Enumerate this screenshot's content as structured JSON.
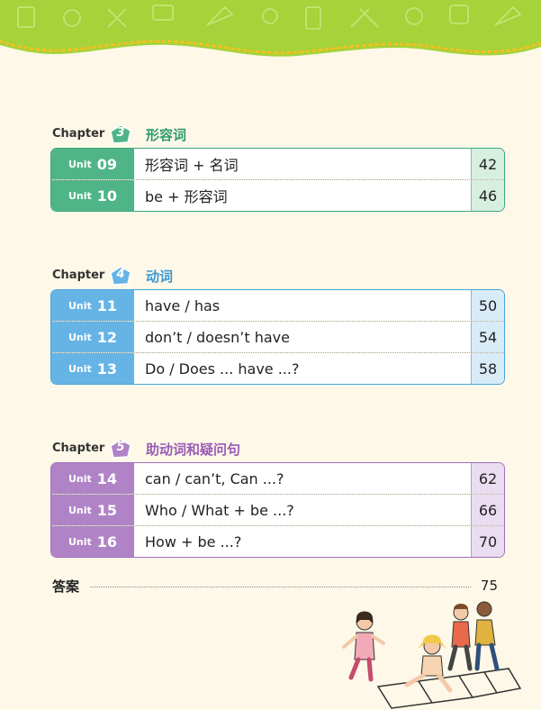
{
  "chapters": [
    {
      "label": "Chapter",
      "number": "3",
      "title": "形容词",
      "units": [
        {
          "label": "Unit",
          "number": "09",
          "topic": "形容词 + 名词",
          "page": "42"
        },
        {
          "label": "Unit",
          "number": "10",
          "topic": "be + 形容词",
          "page": "46"
        }
      ]
    },
    {
      "label": "Chapter",
      "number": "4",
      "title": "动词",
      "units": [
        {
          "label": "Unit",
          "number": "11",
          "topic": "have / has",
          "page": "50"
        },
        {
          "label": "Unit",
          "number": "12",
          "topic": "don’t / doesn’t have",
          "page": "54"
        },
        {
          "label": "Unit",
          "number": "13",
          "topic": "Do / Does ... have ...?",
          "page": "58"
        }
      ]
    },
    {
      "label": "Chapter",
      "number": "5",
      "title": "助动词和疑问句",
      "units": [
        {
          "label": "Unit",
          "number": "14",
          "topic": "can / can’t,  Can ...?",
          "page": "62"
        },
        {
          "label": "Unit",
          "number": "15",
          "topic": "Who / What + be ...?",
          "page": "66"
        },
        {
          "label": "Unit",
          "number": "16",
          "topic": "How + be ...?",
          "page": "70"
        }
      ]
    }
  ],
  "answers": {
    "label": "答案",
    "page": "75"
  },
  "colors": {
    "chapter3": "#4fb589",
    "chapter4": "#66b4e6",
    "chapter5": "#b083c6",
    "banner": "#a6d23a"
  },
  "icons": [
    "school-supplies-pattern",
    "children-hopscotch-illustration"
  ]
}
